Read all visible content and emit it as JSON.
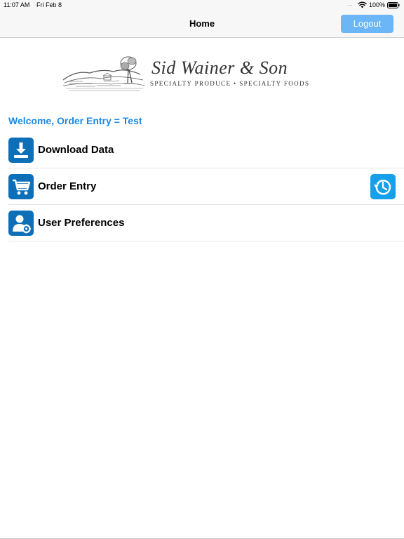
{
  "status_bar": {
    "time": "11:07 AM",
    "date": "Fri Feb 8",
    "signal": "....",
    "battery_percent": "100%",
    "wifi_icon": "wifi-icon",
    "battery_icon": "battery-full-icon"
  },
  "nav": {
    "title": "Home",
    "logout_label": "Logout"
  },
  "logo": {
    "name": "Sid Wainer & Son",
    "tagline": "SPECIALTY PRODUCE • SPECIALTY FOODS"
  },
  "welcome": "Welcome, Order Entry = Test",
  "menu": {
    "items": [
      {
        "label": "Download Data",
        "icon": "download-icon"
      },
      {
        "label": "Order Entry",
        "icon": "cart-icon"
      },
      {
        "label": "User Preferences",
        "icon": "user-settings-icon"
      }
    ],
    "history_icon": "history-icon"
  },
  "colors": {
    "accent": "#1a8ae6",
    "logout_button": "#6ab6f7",
    "menu_icon_bg": "#0d6fb8",
    "history_icon_bg": "#14a0ea",
    "nav_bg": "#f7f7f7"
  }
}
